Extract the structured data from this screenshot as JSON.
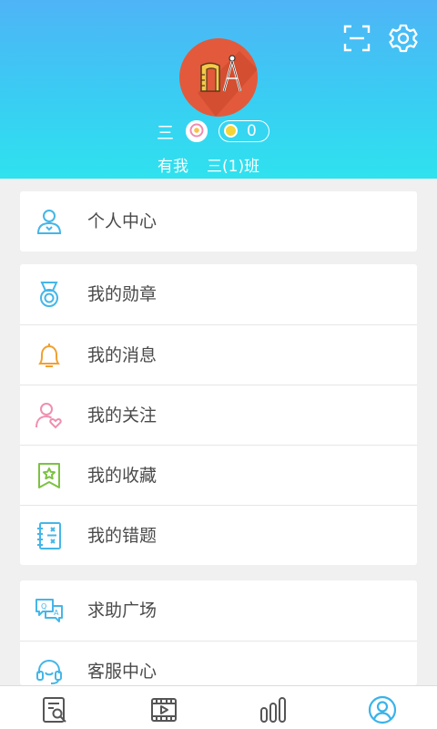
{
  "header": {
    "user_name": "三",
    "coin_count": "0",
    "school": "有我",
    "class_name": "三(1)班"
  },
  "menu": {
    "personal_center": "个人中心",
    "my_medals": "我的勋章",
    "my_messages": "我的消息",
    "my_follows": "我的关注",
    "my_favorites": "我的收藏",
    "my_mistakes": "我的错题",
    "help_square": "求助广场",
    "customer_service": "客服中心"
  },
  "colors": {
    "header_top": "#4fb4f6",
    "header_bottom": "#2fe2ee",
    "avatar_bg": "#e25a3b",
    "icon_blue": "#45b6e8",
    "icon_orange": "#f0a030",
    "icon_pink": "#ef8fb0",
    "icon_green": "#7cc242",
    "tab_active": "#3ab3ea"
  },
  "icons": {
    "scan": "scan-icon",
    "settings": "gear-icon",
    "tabs": [
      "exercise-tab-icon",
      "video-tab-icon",
      "stats-tab-icon",
      "profile-tab-icon"
    ]
  }
}
